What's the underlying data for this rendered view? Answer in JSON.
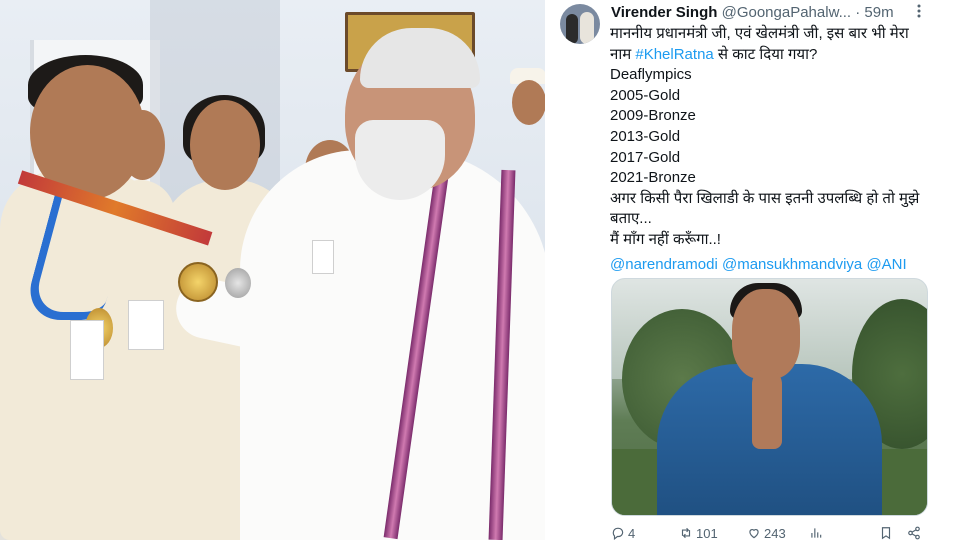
{
  "tweet": {
    "display_name": "Virender Singh",
    "handle": "@GoongaPahalw...",
    "separator": "·",
    "time": "59m",
    "more_icon": "more-dots-icon",
    "lines": [
      "माननीय प्रधानमंत्री जी, एवं खेलमंत्री जी, इस बार भी मेरा",
      "Deaflympics",
      "2005-Gold",
      "2009-Bronze",
      "2013-Gold",
      "2017-Gold",
      "2021-Bronze",
      "अगर किसी पैरा खिलाडी के पास इतनी उपलब्धि हो तो मुझे बताए...",
      "मैं माँग नहीं करूँगा..!"
    ],
    "line2_prefix": "नाम ",
    "hashtag": "#KhelRatna",
    "line2_suffix": " से काट दिया गया?",
    "mentions": [
      "@narendramodi",
      "@mansukhmandviya",
      "@ANI"
    ]
  },
  "actions": {
    "replies": "4",
    "reposts": "101",
    "likes": "243"
  },
  "colors": {
    "link": "#1d9bf0",
    "secondary_text": "#536471",
    "primary_text": "#0f1419"
  }
}
